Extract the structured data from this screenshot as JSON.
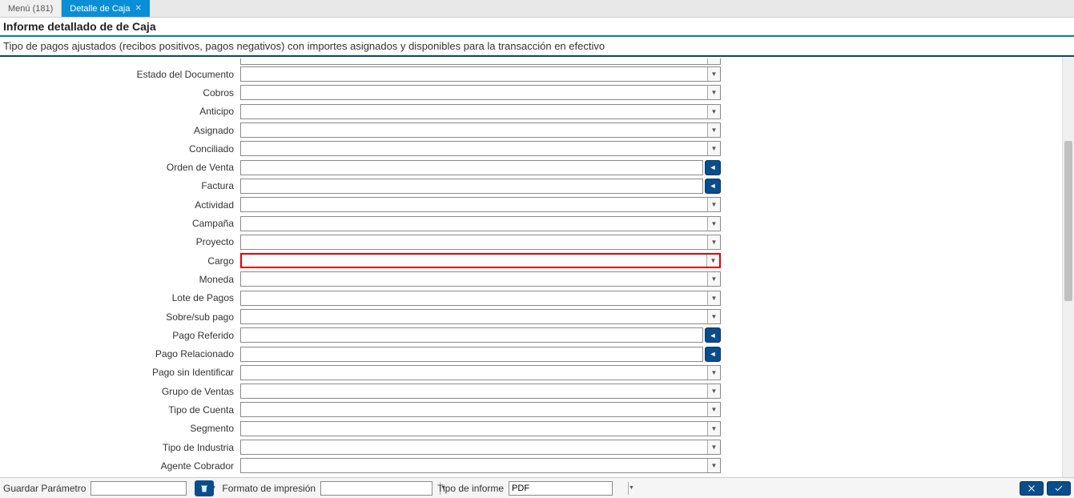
{
  "tabs": {
    "inactive": "Menú (181)",
    "active": "Detalle de Caja"
  },
  "page_title": "Informe detallado de de Caja",
  "subtitle": "Tipo de pagos ajustados (recibos positivos, pagos negativos) con importes asignados y disponibles para la transacción en efectivo",
  "fields": {
    "estado_documento": {
      "label": "Estado del Documento",
      "value": ""
    },
    "cobros": {
      "label": "Cobros",
      "value": ""
    },
    "anticipo": {
      "label": "Anticipo",
      "value": ""
    },
    "asignado": {
      "label": "Asignado",
      "value": ""
    },
    "conciliado": {
      "label": "Conciliado",
      "value": ""
    },
    "orden_venta": {
      "label": "Orden de Venta",
      "value": ""
    },
    "factura": {
      "label": "Factura",
      "value": ""
    },
    "actividad": {
      "label": "Actividad",
      "value": ""
    },
    "campana": {
      "label": "Campaña",
      "value": ""
    },
    "proyecto": {
      "label": "Proyecto",
      "value": ""
    },
    "cargo": {
      "label": "Cargo",
      "value": ""
    },
    "moneda": {
      "label": "Moneda",
      "value": ""
    },
    "lote_pagos": {
      "label": "Lote de Pagos",
      "value": ""
    },
    "sobre_sub": {
      "label": "Sobre/sub pago",
      "value": ""
    },
    "pago_referido": {
      "label": "Pago Referido",
      "value": ""
    },
    "pago_relacionado": {
      "label": "Pago Relacionado",
      "value": ""
    },
    "pago_sin_ident": {
      "label": "Pago sin Identificar",
      "value": ""
    },
    "grupo_ventas": {
      "label": "Grupo de Ventas",
      "value": ""
    },
    "tipo_cuenta": {
      "label": "Tipo de Cuenta",
      "value": ""
    },
    "segmento": {
      "label": "Segmento",
      "value": ""
    },
    "tipo_industria": {
      "label": "Tipo de Industria",
      "value": ""
    },
    "agente_cobrador": {
      "label": "Agente Cobrador",
      "value": ""
    }
  },
  "footer": {
    "guardar_param": "Guardar Parámetro",
    "guardar_value": "",
    "formato_impresion": "Formato de impresión",
    "formato_value": "",
    "tipo_informe": "Tipo de informe",
    "tipo_value": "PDF"
  }
}
